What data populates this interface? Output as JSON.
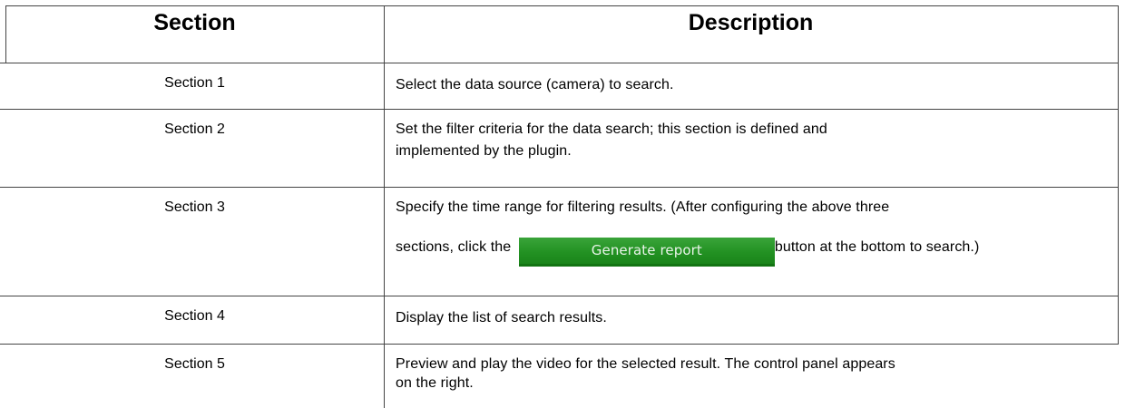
{
  "table": {
    "headers": {
      "section": "Section",
      "description": "Description"
    },
    "rows": [
      {
        "section": "Section 1",
        "description": "Select the data source (camera) to search."
      },
      {
        "section": "Section 2",
        "description_line1": "Set the filter criteria for the data search; this section is defined and",
        "description_line2": "implemented by the plugin."
      },
      {
        "section": "Section 3",
        "description_line1": "Specify the time range for filtering results. (After configuring the above three",
        "description_line2_before": "sections, click the",
        "button_label": "Generate report",
        "description_line2_after": "button at the bottom to search.)"
      },
      {
        "section": "Section 4",
        "description": "Display the list of search results."
      },
      {
        "section": "Section 5",
        "description_line1": "Preview and play the video for the selected result. The control panel appears",
        "description_line2": "on the right."
      }
    ]
  },
  "colors": {
    "button_green": "#239223",
    "button_text": "#e9f3e9",
    "grid": "#444444"
  }
}
